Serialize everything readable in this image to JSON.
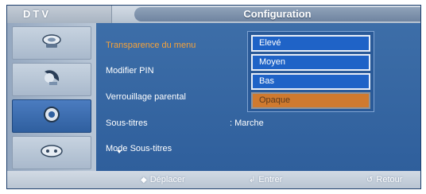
{
  "header": {
    "source": "DTV",
    "title": "Configuration"
  },
  "sidebar": {
    "icons": [
      "satellite-dish-icon",
      "antenna-icon",
      "gear-icon",
      "network-icon"
    ],
    "active_index": 0
  },
  "menu": {
    "items": [
      {
        "label": "Transparence du menu",
        "value": ""
      },
      {
        "label": "Modifier PIN",
        "value": ""
      },
      {
        "label": "Verrouillage parental",
        "value": ""
      },
      {
        "label": "Sous-titres",
        "value": ": Marche"
      },
      {
        "label": "Mode Sous-titres",
        "value": ""
      }
    ],
    "selected_index": 0
  },
  "dropdown": {
    "options": [
      "Elevé",
      "Moyen",
      "Bas",
      "Opaque"
    ],
    "selected_index": 3
  },
  "footer": {
    "move": "Déplacer",
    "enter": "Entrer",
    "return": "Retour"
  },
  "colors": {
    "highlight": "#f5a23a",
    "panel": "#2e5f9c",
    "option_bg": "#1f63c7",
    "option_selected": "#cf7a2f"
  }
}
